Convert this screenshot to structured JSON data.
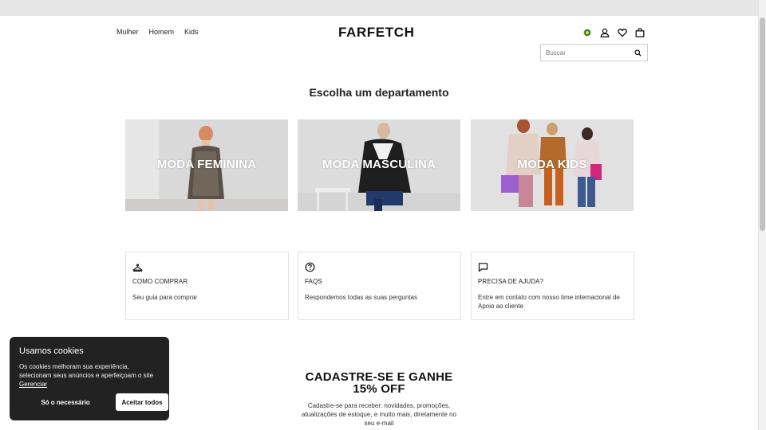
{
  "header": {
    "nav": [
      "Mulher",
      "Homem",
      "Kids"
    ],
    "logo": "FARFETCH",
    "icons": [
      "country-flag-icon",
      "account-icon",
      "wishlist-icon",
      "bag-icon"
    ],
    "search": {
      "placeholder": "Buscar",
      "value": ""
    }
  },
  "main": {
    "title": "Escolha um departamento",
    "departments": [
      {
        "label": "MODA FEMININA"
      },
      {
        "label": "MODA MASCULINA"
      },
      {
        "label": "MODA KIDS"
      }
    ],
    "help_cards": [
      {
        "icon": "hanger-icon",
        "title": "COMO COMPRAR",
        "desc": "Seu guia para comprar"
      },
      {
        "icon": "question-icon",
        "title": "FAQS",
        "desc": "Respondemos todas as suas perguntas"
      },
      {
        "icon": "chat-icon",
        "title": "PRECISA DE AJUDA?",
        "desc": "Entre em contato com nosso time internacional de Apoio ao cliente"
      }
    ]
  },
  "signup": {
    "title_line1": "CADASTRE-SE E GANHE",
    "title_line2": "15% OFF",
    "text": "Cadastre-se para receber: novidades, promoções, atualizações de estoque, e muito mais, diretamente no seu e-mail"
  },
  "cookie": {
    "title": "Usamos cookies",
    "text": "Os cookies melhoram sua experiência, selecionam seus anúncios e aperfeiçoam o site",
    "manage_link": "Gerenciar",
    "necessary_button": "Só o necessário",
    "accept_button": "Aceitar todos"
  }
}
